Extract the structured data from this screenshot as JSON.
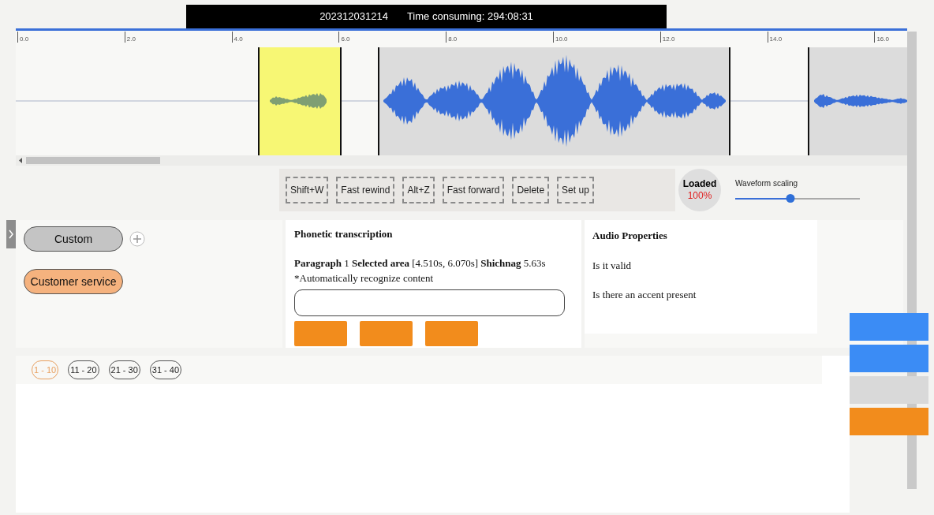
{
  "title_bar": {
    "id": "202312031214",
    "time": "Time consuming: 294:08:31"
  },
  "waveform": {
    "ruler": [
      "0.0",
      "2.0",
      "4.0",
      "6.0",
      "8.0",
      "10.0",
      "12.0",
      "14.0",
      "16.0"
    ],
    "segments": [
      {
        "selected": true
      },
      {
        "selected": false
      },
      {
        "selected": false
      }
    ]
  },
  "toolbar": {
    "buttons": [
      "Shift+W",
      "Fast rewind",
      "Alt+Z",
      "Fast forward",
      "Delete",
      "Set up"
    ],
    "loaded": {
      "label": "Loaded",
      "value": "100%"
    },
    "scaling": {
      "label": "Waveform scaling",
      "level": 0.44
    }
  },
  "sidebar": {
    "tags": [
      {
        "label": "Custom",
        "color": "#c4c4c4"
      },
      {
        "label": "Customer service",
        "color": "#f5b27e"
      }
    ]
  },
  "transcription": {
    "title": "Phonetic transcription",
    "info": "**Paragraph** 1 **Selected area** [4.510s, 6.070s] **Shichnag** 5.63s",
    "note": "*Automatically recognize content"
  },
  "audio_properties": {
    "title": "Audio Properties",
    "items": [
      "Is it valid",
      "Is there an accent present"
    ]
  },
  "pager": [
    {
      "label": "1 - 10",
      "selected": true
    },
    {
      "label": "11 - 20",
      "selected": false
    },
    {
      "label": "21 - 30",
      "selected": false
    },
    {
      "label": "31 - 40",
      "selected": false
    }
  ],
  "side_buttons": [
    {
      "color": "#3b8cf5"
    },
    {
      "color": "#3b8cf5"
    },
    {
      "color": "#d9d9d9"
    },
    {
      "color": "#f28c1c"
    }
  ]
}
